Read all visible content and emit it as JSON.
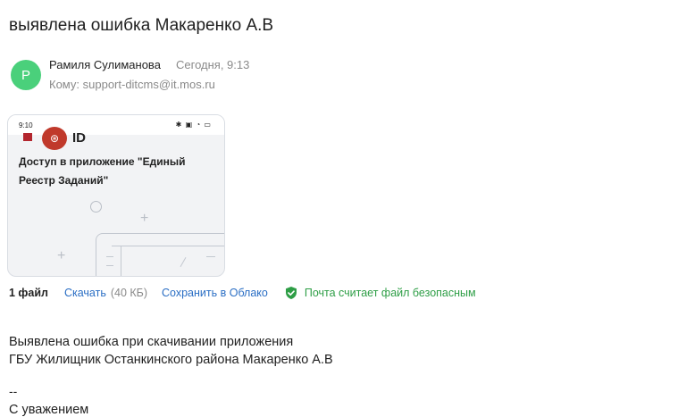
{
  "email": {
    "subject": "выявлена ошибка Макаренко А.В",
    "sender": {
      "avatar_letter": "Р",
      "avatar_color": "#4ad07b",
      "name": "Рамиля Сулиманова",
      "time": "Сегодня, 9:13"
    },
    "recipient_label": "Кому:",
    "recipient": "support-ditcms@it.mos.ru",
    "attachment_preview": {
      "status_time": "9:10",
      "status_icons": "✱ ▣ ◔ ▭",
      "logo_text": "ID",
      "heading": "Доступ в приложение \"Единый Реестр Заданий\""
    },
    "attachments": {
      "count_label": "1 файл",
      "download_label": "Скачать",
      "download_size": "(40 КБ)",
      "save_label": "Сохранить в Облако",
      "safety_text": "Почта считает файл безопасным",
      "safety_color": "#2e9e46",
      "link_color": "#2a6ec4"
    },
    "body": {
      "line1": "Выявлена ошибка при скачивании приложения",
      "line2": "ГБУ Жилищник Останкинского района Макаренко А.В",
      "signature_dash": "--",
      "signature_regards": "С уважением"
    }
  }
}
